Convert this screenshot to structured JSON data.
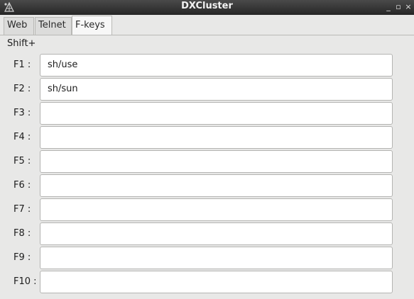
{
  "window": {
    "title": "DXCluster",
    "controls": {
      "minimize": "_",
      "maximize": "▫",
      "close": "×"
    }
  },
  "tabs": [
    {
      "label": "Web",
      "active": false
    },
    {
      "label": "Telnet",
      "active": false
    },
    {
      "label": "F-keys",
      "active": true
    }
  ],
  "fkeys": {
    "modifier_label": "Shift+",
    "rows": [
      {
        "label": "F1 :",
        "value": "sh/use"
      },
      {
        "label": "F2 :",
        "value": "sh/sun"
      },
      {
        "label": "F3 :",
        "value": ""
      },
      {
        "label": "F4 :",
        "value": ""
      },
      {
        "label": "F5 :",
        "value": ""
      },
      {
        "label": "F6 :",
        "value": ""
      },
      {
        "label": "F7 :",
        "value": ""
      },
      {
        "label": "F8 :",
        "value": ""
      },
      {
        "label": "F9 :",
        "value": ""
      },
      {
        "label": "F10 :",
        "value": ""
      }
    ]
  },
  "colors": {
    "titlebar": "#333333",
    "background": "#e8e8e7",
    "input_background": "#ffffff"
  },
  "icons": [
    "app-icon",
    "minimize-icon",
    "maximize-icon",
    "close-icon"
  ]
}
